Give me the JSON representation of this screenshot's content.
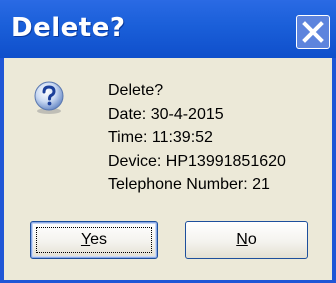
{
  "dialog": {
    "title": "Delete?",
    "message_lines": [
      "Delete?",
      "Date: 30-4-2015",
      "Time: 11:39:52",
      "Device: HP13991851620",
      "Telephone Number: 21"
    ],
    "buttons": {
      "yes": {
        "mnemonic": "Y",
        "rest": "es"
      },
      "no": {
        "mnemonic": "N",
        "rest": "o"
      }
    },
    "icon": "question-icon",
    "close_icon": "close-icon"
  },
  "colors": {
    "titlebar": "#1a5fd9",
    "client": "#ece9d8",
    "border": "#1f56d6",
    "close_button": "#5d84dd"
  }
}
